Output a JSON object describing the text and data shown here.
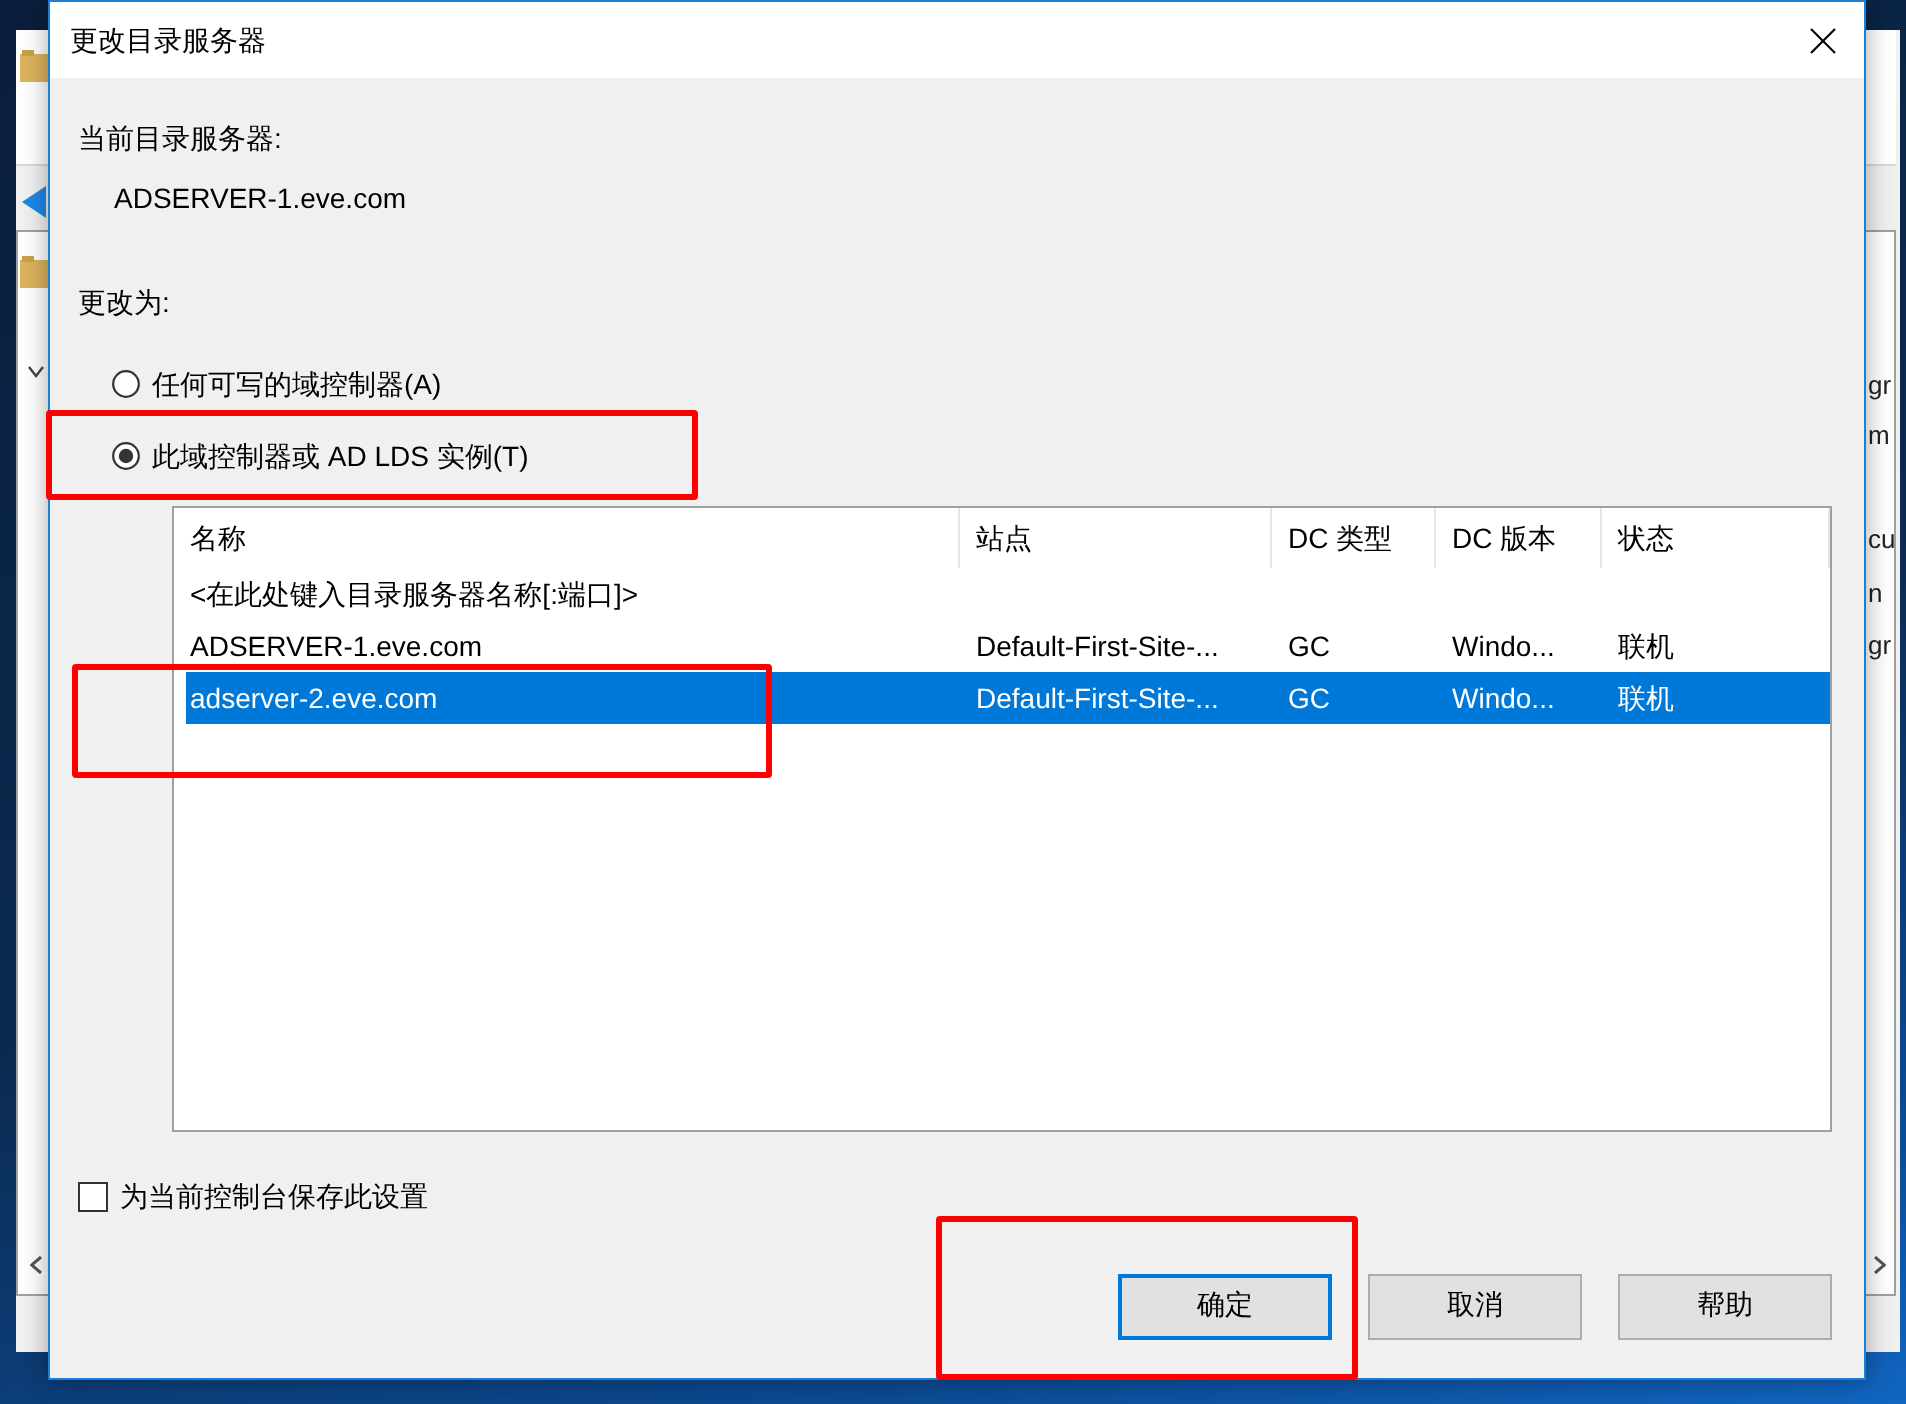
{
  "window": {
    "title": "更改目录服务器"
  },
  "current_server": {
    "label": "当前目录服务器:",
    "value": "ADSERVER-1.eve.com"
  },
  "change_to": {
    "label": "更改为:",
    "options": [
      {
        "label": "任何可写的域控制器(A)",
        "selected": false,
        "highlighted": false
      },
      {
        "label": "此域控制器或 AD LDS 实例(T)",
        "selected": true,
        "highlighted": true
      }
    ]
  },
  "server_list": {
    "columns": [
      "名称",
      "站点",
      "DC 类型",
      "DC 版本",
      "状态"
    ],
    "new_entry": "<在此处键入目录服务器名称[:端口]>",
    "rows": [
      {
        "cells": [
          "ADSERVER-1.eve.com",
          "Default-First-Site-...",
          "GC",
          "Windo...",
          "联机"
        ],
        "selected": false,
        "highlighted": false
      },
      {
        "cells": [
          "adserver-2.eve.com",
          "Default-First-Site-...",
          "GC",
          "Windo...",
          "联机"
        ],
        "selected": true,
        "highlighted": true
      }
    ]
  },
  "save_setting": {
    "label": "为当前控制台保存此设置",
    "checked": false
  },
  "buttons": [
    {
      "label": "确定",
      "default": true,
      "highlighted": true
    },
    {
      "label": "取消",
      "default": false,
      "highlighted": false
    },
    {
      "label": "帮助",
      "default": false,
      "highlighted": false
    }
  ],
  "background_window": {
    "fragments": [
      "gr",
      "m",
      "cu",
      "n",
      "gr"
    ]
  }
}
